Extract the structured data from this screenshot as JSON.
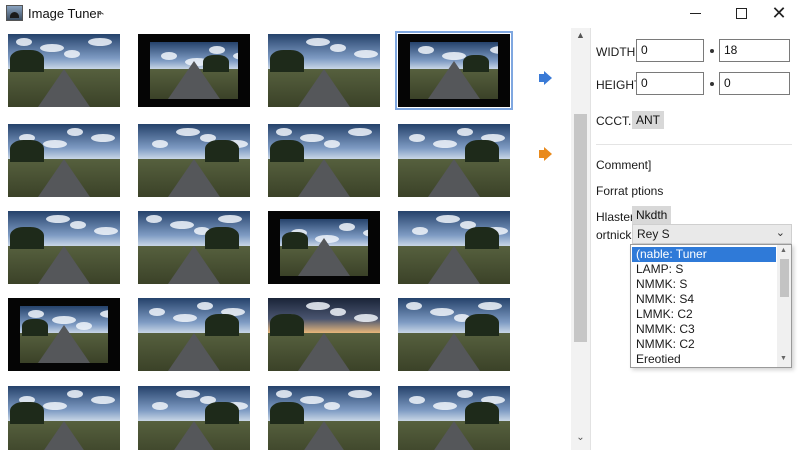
{
  "window": {
    "title": "Image Tuner",
    "title_suffix": "⌁",
    "minimize_icon": "minimize-icon",
    "maximize_icon": "maximize-icon",
    "close_icon": "close-icon",
    "close_glyph": "✕"
  },
  "grid": {
    "selected_index": 3,
    "thumbnails_count": 20
  },
  "side_icons": [
    "speaker-blue-icon",
    "speaker-orange-icon"
  ],
  "panel": {
    "width_label": "WIDTH:",
    "width_value_1": "0",
    "width_value_2": "18",
    "height_label": "HEIGHT:",
    "height_value_1": "0",
    "height_value_2": "0",
    "ccct_label": "CCCT.",
    "ccct_chip": "ANT",
    "comment_label": "Comment]",
    "format_label": "Forrat ptions",
    "hlaster_label": "Hlaster",
    "hlaster_chip": "Nkdth",
    "ortnick_label": "ortnick",
    "combo_value": "Rey S",
    "combo_chevron": "⌄",
    "options": [
      "(nable: Tuner",
      "LAMP: S",
      "NMMK: S",
      "NMMK: S4",
      "LMMK: C2",
      "NMMK: C3",
      "NMMK: C2",
      "Ereotied"
    ],
    "selected_option": 0
  },
  "colors": {
    "selection": "#2f7ad8",
    "accent_blue": "#3a7ad6",
    "accent_orange": "#e98a1c"
  }
}
